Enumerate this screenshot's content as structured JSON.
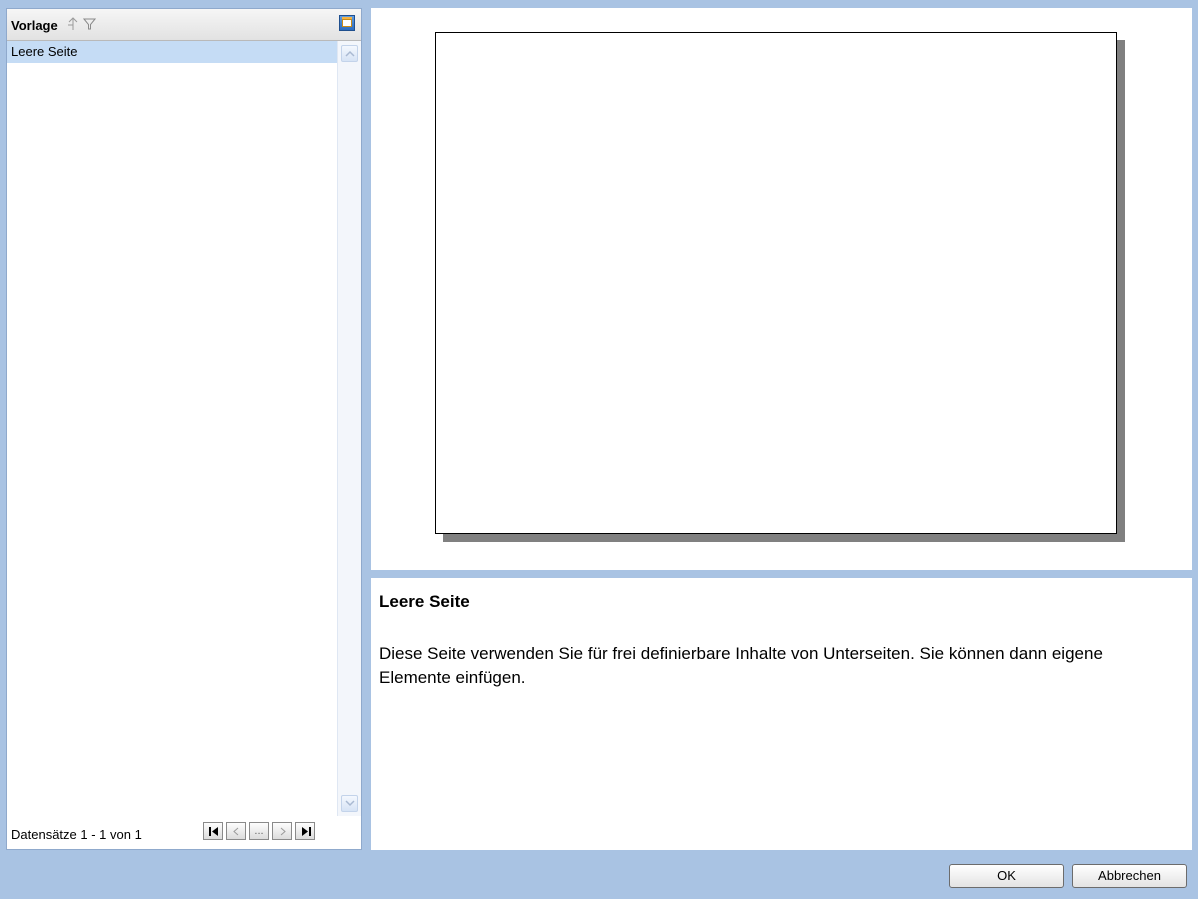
{
  "grid": {
    "column_title": "Vorlage",
    "rows": [
      {
        "label": "Leere Seite",
        "selected": true
      }
    ],
    "pager": {
      "status_text": "Datensätze 1 - 1 von 1",
      "ellipsis_label": "..."
    }
  },
  "description": {
    "title": "Leere Seite",
    "text": "Diese Seite verwenden Sie für frei definierbare Inhalte von Unterseiten. Sie können dann eigene Elemente einfügen."
  },
  "buttons": {
    "ok_label": "OK",
    "cancel_label": "Abbrechen"
  },
  "colors": {
    "dialog_background": "#a9c3e3",
    "selected_row": "#c5dcf5"
  }
}
